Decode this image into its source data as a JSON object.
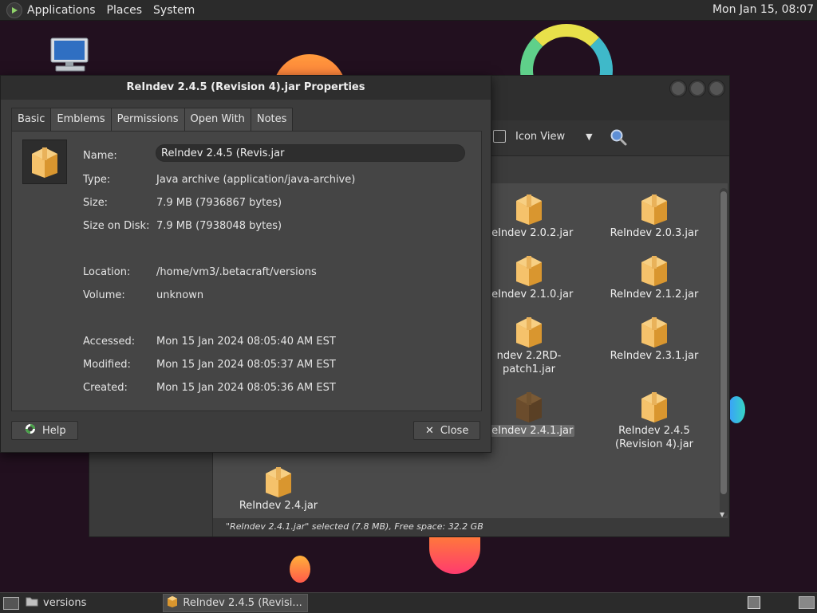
{
  "top_panel": {
    "menus": [
      "Applications",
      "Places",
      "System"
    ],
    "clock": "Mon Jan 15, 08:07"
  },
  "dialog": {
    "title": "ReIndev 2.4.5 (Revision 4).jar Properties",
    "tabs": [
      "Basic",
      "Emblems",
      "Permissions",
      "Open With",
      "Notes"
    ],
    "active_tab": "Basic",
    "fields": {
      "name_label": "Name:",
      "name_value": "ReIndev 2.4.5 (Revis.jar",
      "type_label": "Type:",
      "type_value": "Java archive (application/java-archive)",
      "size_label": "Size:",
      "size_value": "7.9 MB (7936867 bytes)",
      "disk_label": "Size on Disk:",
      "disk_value": "7.9 MB (7938048 bytes)",
      "location_label": "Location:",
      "location_value": "/home/vm3/.betacraft/versions",
      "volume_label": "Volume:",
      "volume_value": "unknown",
      "accessed_label": "Accessed:",
      "accessed_value": "Mon 15 Jan 2024 08:05:40 AM EST",
      "modified_label": "Modified:",
      "modified_value": "Mon 15 Jan 2024 08:05:37 AM EST",
      "created_label": "Created:",
      "created_value": "Mon 15 Jan 2024 08:05:36 AM EST"
    },
    "help_label": "Help",
    "close_label": "Close"
  },
  "file_manager": {
    "view_mode": "Icon View",
    "files": [
      {
        "label": "ReIndev 2.0.2.jar"
      },
      {
        "label": "ReIndev 2.0.3.jar"
      },
      {
        "label": "ReIndev 2.1.0.jar"
      },
      {
        "label": "ReIndev 2.1.2.jar"
      },
      {
        "label": "ndev 2.2RD-patch1.jar"
      },
      {
        "label": "ReIndev 2.3.1.jar"
      },
      {
        "label": "ReIndev 2.4.1.jar"
      },
      {
        "label": "ReIndev 2.4.5 (Revision 4).jar"
      },
      {
        "label": "ReIndev 2.4.jar"
      }
    ],
    "status": "\"ReIndev 2.4.1.jar\" selected (7.8 MB), Free space: 32.2 GB"
  },
  "taskbar": {
    "tasks": [
      "versions",
      "ReIndev 2.4.5 (Revisi..."
    ]
  },
  "colors": {
    "jar_light": "#f5c26b",
    "jar_dark": "#d9962f",
    "panel_bg": "#2b2b2b",
    "desktop_bg": "#22101f"
  }
}
